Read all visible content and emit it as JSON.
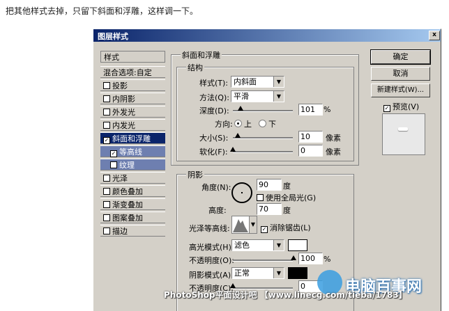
{
  "caption": "把其他样式去掉，只留下斜面和浮雕，这样调一下。",
  "dialog": {
    "title": "图层样式",
    "close": "x"
  },
  "list": {
    "header": "样式",
    "blend": "混合选项:自定",
    "items": [
      {
        "label": "投影",
        "checked": false
      },
      {
        "label": "内阴影",
        "checked": false
      },
      {
        "label": "外发光",
        "checked": false
      },
      {
        "label": "内发光",
        "checked": false
      },
      {
        "label": "斜面和浮雕",
        "checked": true,
        "selected": true
      },
      {
        "label": "等高线",
        "checked": true,
        "sub": true
      },
      {
        "label": "纹理",
        "checked": false,
        "sub": true
      },
      {
        "label": "光泽",
        "checked": false
      },
      {
        "label": "颜色叠加",
        "checked": false
      },
      {
        "label": "渐变叠加",
        "checked": false
      },
      {
        "label": "图案叠加",
        "checked": false
      },
      {
        "label": "描边",
        "checked": false
      }
    ]
  },
  "bevel": {
    "section": "斜面和浮雕",
    "structure": "结构",
    "style_label": "样式(T):",
    "style_value": "内斜面",
    "method_label": "方法(Q):",
    "method_value": "平滑",
    "depth_label": "深度(D):",
    "depth_value": "101",
    "depth_unit": "%",
    "direction_label": "方向:",
    "dir_up": "上",
    "dir_down": "下",
    "size_label": "大小(S):",
    "size_value": "10",
    "size_unit": "像素",
    "soften_label": "软化(F):",
    "soften_value": "0",
    "soften_unit": "像素"
  },
  "shading": {
    "section": "阴影",
    "angle_label": "角度(N):",
    "angle_value": "90",
    "angle_unit": "度",
    "global_light": "使用全局光(G)",
    "altitude_label": "高度:",
    "altitude_value": "70",
    "altitude_unit": "度",
    "gloss_label": "光泽等高线:",
    "antialias": "消除锯齿(L)",
    "highlight_label": "高光模式(H):",
    "highlight_value": "滤色",
    "highlight_color": "#ffffff",
    "hl_opacity_label": "不透明度(O):",
    "hl_opacity_value": "100",
    "hl_opacity_unit": "%",
    "shadow_label": "阴影模式(A):",
    "shadow_value": "正常",
    "shadow_color": "#000000",
    "sh_opacity_label": "不透明度(C):",
    "sh_opacity_value": "0"
  },
  "buttons": {
    "ok": "确定",
    "cancel": "取消",
    "new_style": "新建样式(W)...",
    "preview": "预览(V)"
  },
  "watermark": {
    "bar": "PhotoShop平面设计吧 【www.linecg.com/tieba/1783】",
    "brand": "电脑百事网"
  }
}
